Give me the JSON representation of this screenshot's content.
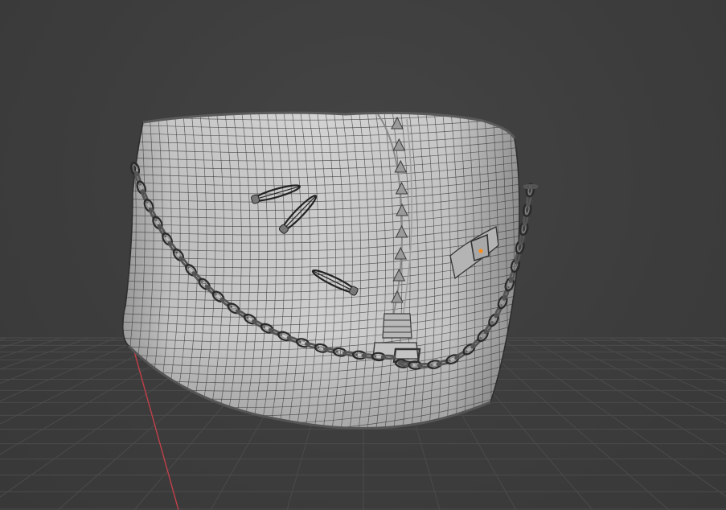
{
  "viewport": {
    "background_color": "#3d3d3d",
    "grid_color": "#4b4b4b",
    "x_axis_color": "#c0404a",
    "mesh_color": "#c9c9c9",
    "wire_color": "#3a3a3a",
    "origin_color": "#ff8c1a",
    "objects": [
      {
        "name": "corset-mesh"
      },
      {
        "name": "chain"
      },
      {
        "name": "safety-pins"
      },
      {
        "name": "studs"
      },
      {
        "name": "buckle"
      },
      {
        "name": "patch"
      }
    ]
  }
}
